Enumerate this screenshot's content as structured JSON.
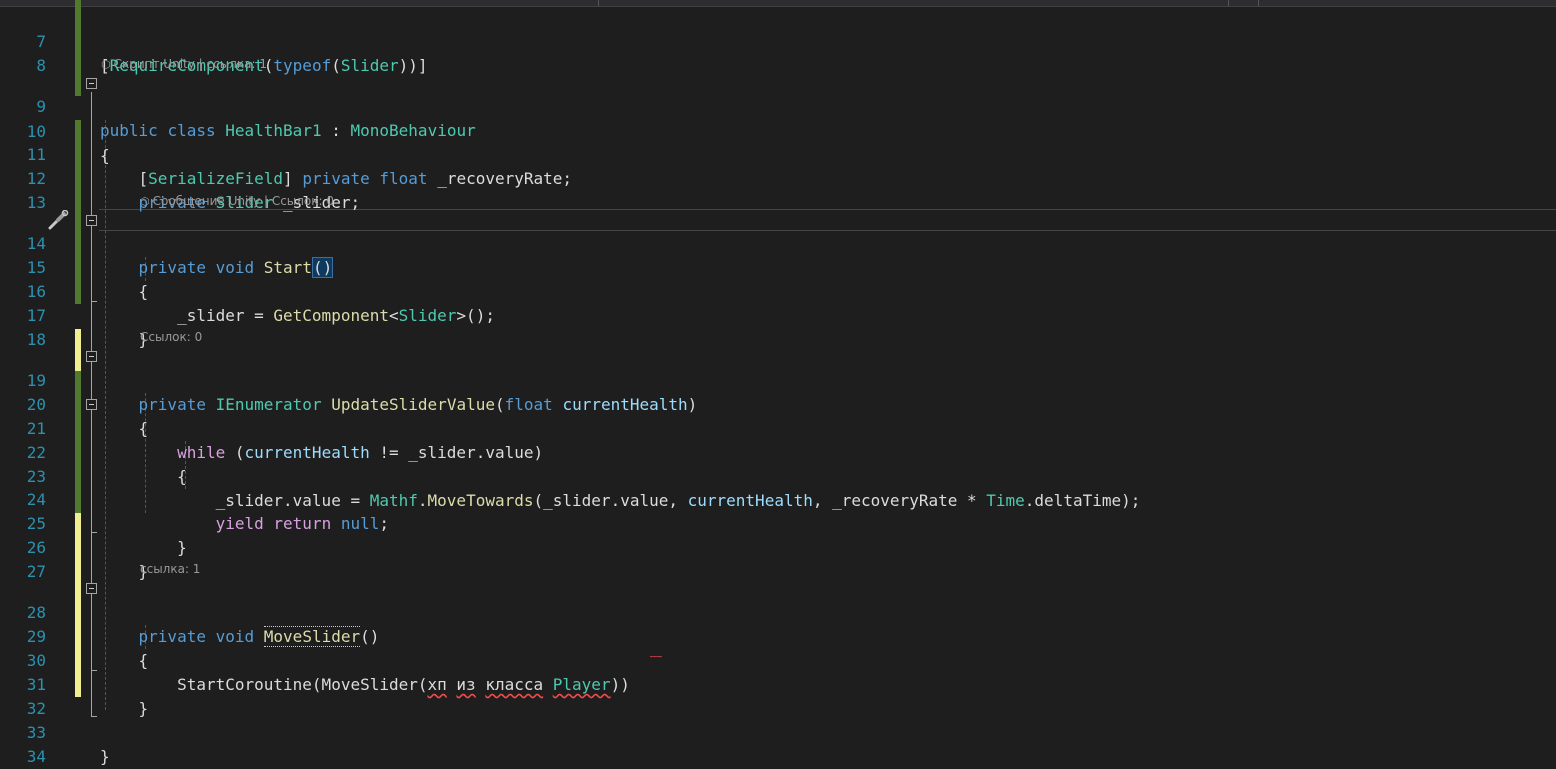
{
  "editor": {
    "lines": [
      {
        "number": "7",
        "text": "[RequireComponent(typeof(Slider))]"
      },
      {
        "number": "8",
        "text": ""
      },
      {
        "number": "9",
        "text": "public class HealthBar1 : MonoBehaviour"
      },
      {
        "number": "10",
        "text": "{"
      },
      {
        "number": "11",
        "text": "    [SerializeField] private float _recoveryRate;"
      },
      {
        "number": "12",
        "text": "    private Slider _slider;"
      },
      {
        "number": "13",
        "text": ""
      },
      {
        "number": "14",
        "text": "    private void Start()"
      },
      {
        "number": "15",
        "text": "    {"
      },
      {
        "number": "16",
        "text": "        _slider = GetComponent<Slider>();"
      },
      {
        "number": "17",
        "text": "    }"
      },
      {
        "number": "18",
        "text": ""
      },
      {
        "number": "19",
        "text": "    private IEnumerator UpdateSliderValue(float currentHealth)"
      },
      {
        "number": "20",
        "text": "    {"
      },
      {
        "number": "21",
        "text": "        while (currentHealth != _slider.value)"
      },
      {
        "number": "22",
        "text": "        {"
      },
      {
        "number": "23",
        "text": "            _slider.value = Mathf.MoveTowards(_slider.value, currentHealth, _recoveryRate * Time.deltaTime);"
      },
      {
        "number": "24",
        "text": "            yield return null;"
      },
      {
        "number": "25",
        "text": "        }"
      },
      {
        "number": "26",
        "text": "    }"
      },
      {
        "number": "27",
        "text": ""
      },
      {
        "number": "28",
        "text": "    private void MoveSlider()"
      },
      {
        "number": "29",
        "text": "    {"
      },
      {
        "number": "30",
        "text": "        StartCoroutine(MoveSlider(хп из класса Player))"
      },
      {
        "number": "31",
        "text": "    }"
      },
      {
        "number": "32",
        "text": ""
      },
      {
        "number": "33",
        "text": "}"
      },
      {
        "number": "34",
        "text": ""
      }
    ],
    "code_lens": {
      "class_hint": {
        "label": "Скрипт Unity",
        "refs": "ссылка: 1"
      },
      "start_hint": {
        "label": "Сообщение Unity",
        "refs": "Ссылок: 0"
      },
      "update_hint": {
        "refs": "Ссылок: 0"
      },
      "move_hint": {
        "refs": "ссылка: 1"
      }
    },
    "icons": {
      "code_lens": "unity-cube-icon",
      "quick_action": "screwdriver-icon",
      "fold": "collapse-icon"
    },
    "colors": {
      "background": "#1e1e1e",
      "line_number": "#2b91af",
      "keyword": "#569cd6",
      "type": "#4ec9b0",
      "method": "#dcdcaa",
      "control": "#d8a0df",
      "parameter": "#9cdcfe",
      "saved_change": "#527a2e",
      "unsaved_change": "#efef91",
      "error": "#f14c4c"
    }
  }
}
